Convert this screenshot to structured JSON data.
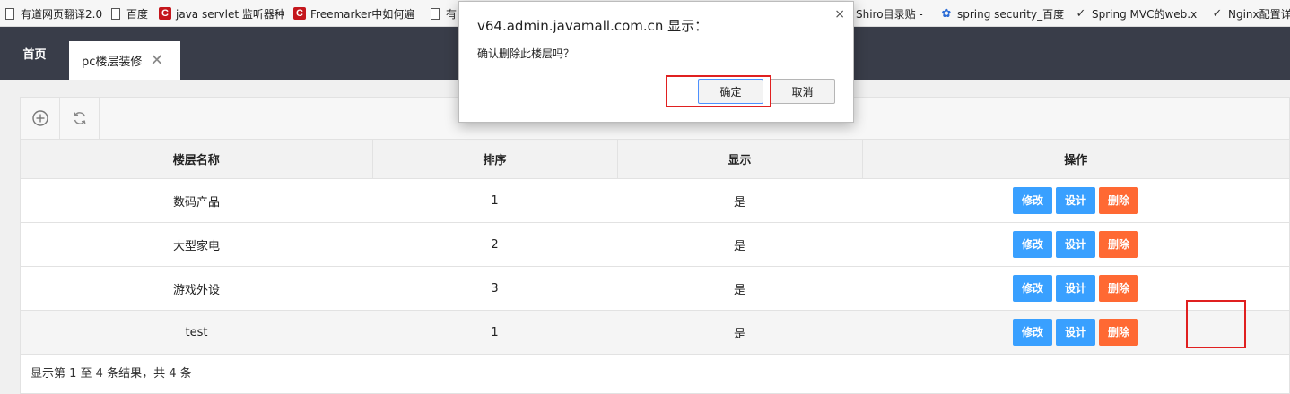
{
  "bookmarks": [
    {
      "label": "有道网页翻译2.0",
      "icon": "page-icon"
    },
    {
      "label": "百度",
      "icon": "page-icon"
    },
    {
      "label": "java servlet 监听器种",
      "icon": "c-icon"
    },
    {
      "label": "Freemarker中如何遍",
      "icon": "c-icon"
    },
    {
      "label": "有",
      "icon": "page-icon"
    },
    {
      "label": "Shiro目录贴 -",
      "icon": "none"
    },
    {
      "label": "spring security_百度",
      "icon": "paw-icon"
    },
    {
      "label": "Spring MVC的web.x",
      "icon": "check-icon"
    },
    {
      "label": "Nginx配置详",
      "icon": "check-icon"
    }
  ],
  "nav": {
    "home": "首页",
    "active_tab": "pc楼层装修",
    "close_glyph": "✕"
  },
  "toolbar": {
    "add_icon": "plus-circle-icon",
    "refresh_icon": "refresh-icon"
  },
  "table": {
    "headers": [
      "楼层名称",
      "排序",
      "显示",
      "操作"
    ],
    "rows": [
      {
        "name": "数码产品",
        "sort": "1",
        "show": "是"
      },
      {
        "name": "大型家电",
        "sort": "2",
        "show": "是"
      },
      {
        "name": "游戏外设",
        "sort": "3",
        "show": "是"
      },
      {
        "name": "test",
        "sort": "1",
        "show": "是"
      }
    ],
    "actions": {
      "edit": "修改",
      "design": "设计",
      "delete": "删除"
    }
  },
  "footer": "显示第 1 至 4 条结果，共 4 条",
  "dialog": {
    "title": "v64.admin.javamall.com.cn 显示：",
    "message": "确认删除此楼层吗？",
    "ok": "确定",
    "cancel": "取消",
    "close_glyph": "×"
  },
  "colors": {
    "nav_bg": "#393d49",
    "btn_blue": "#39a0ff",
    "btn_orange": "#ff6933",
    "highlight": "#e02020"
  }
}
